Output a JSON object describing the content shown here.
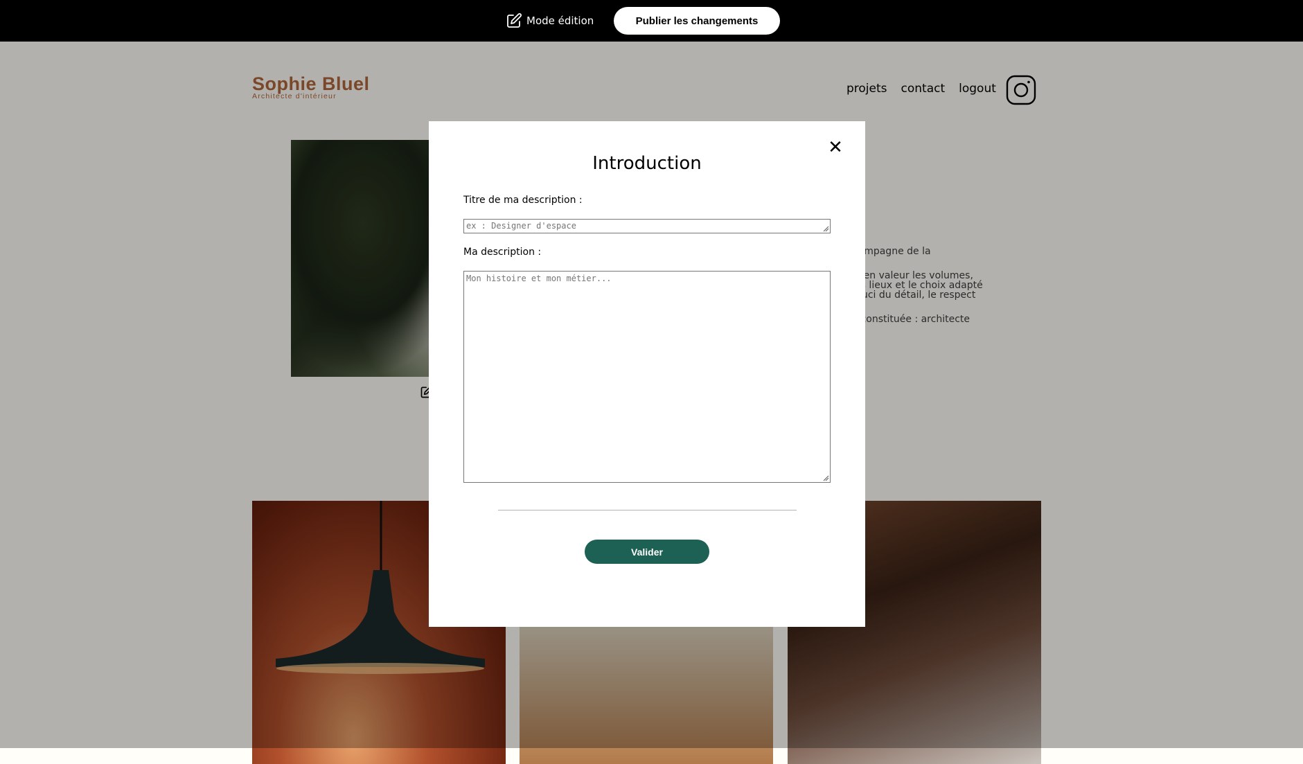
{
  "edit_bar": {
    "mode_label": "Mode édition",
    "publish_label": "Publier les changements"
  },
  "header": {
    "logo_title": "Sophie Bluel",
    "logo_subtitle": "Architecte d'intérieur",
    "nav": [
      "projets",
      "contact",
      "logout"
    ],
    "instagram_icon": "instagram-icon"
  },
  "intro": {
    "paragraphs": [
      "Je vous accompagne de la",
      "on à mettre en valeur les volumes,",
      "e l'esprit des lieux et le choix adapté",
      "é dans le souci du détail, le respect",
      "e peut-être constituée : architecte"
    ]
  },
  "modal": {
    "title": "Introduction",
    "close_icon": "close-icon",
    "title_label": "Titre de ma description :",
    "title_placeholder": "ex : Designer d'espace",
    "description_label": "Ma description :",
    "description_placeholder": "Mon histoire et mon métier...",
    "submit_label": "Valider"
  },
  "colors": {
    "brand": "#B1663C",
    "accent": "#1D6154",
    "edit_bar": "#000000",
    "page_bg": "#FFFEF8"
  }
}
